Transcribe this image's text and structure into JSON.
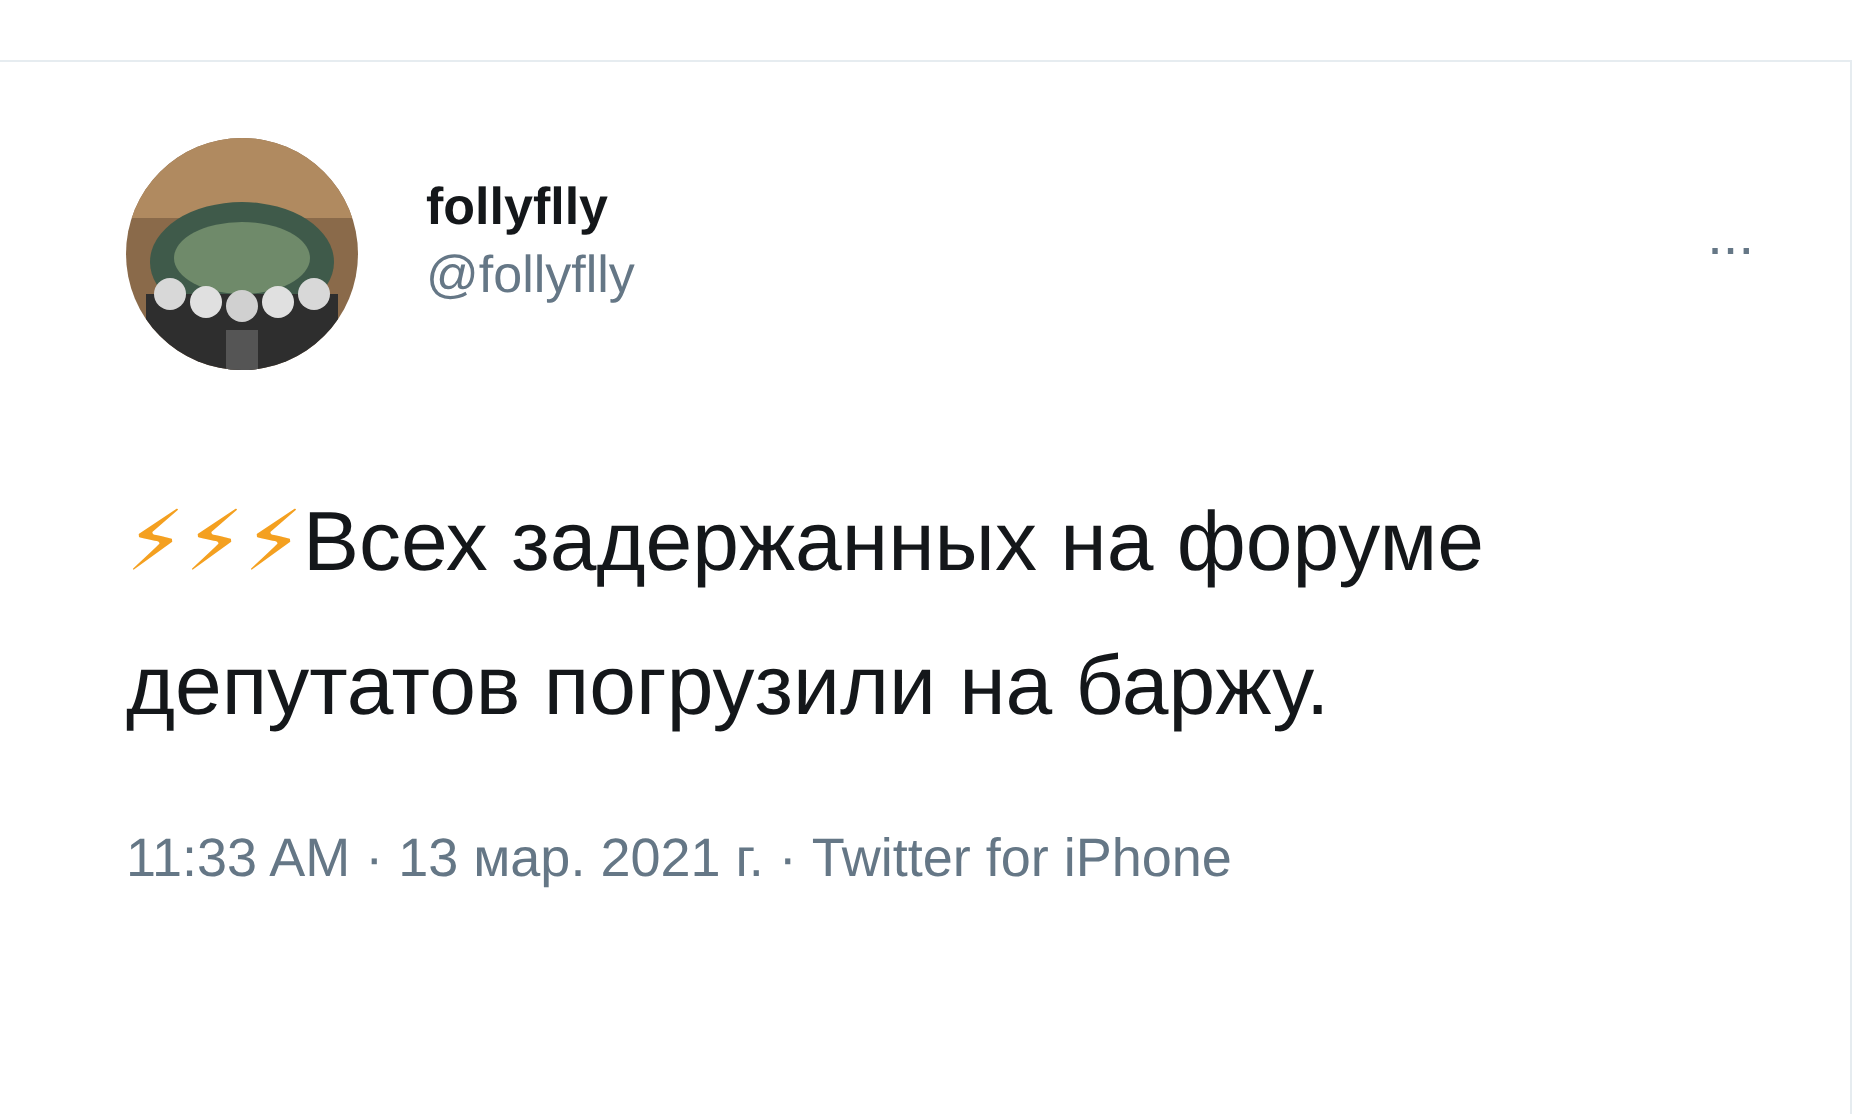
{
  "author": {
    "name": "follyflly",
    "handle": "@follyflly"
  },
  "more": "...",
  "tweet": {
    "icons": "⚡⚡⚡",
    "text": "Всех задержанных на форуме депутатов погрузили на баржу."
  },
  "footer": "11:33 AM · 13 мар. 2021 г. · Twitter for iPhone"
}
